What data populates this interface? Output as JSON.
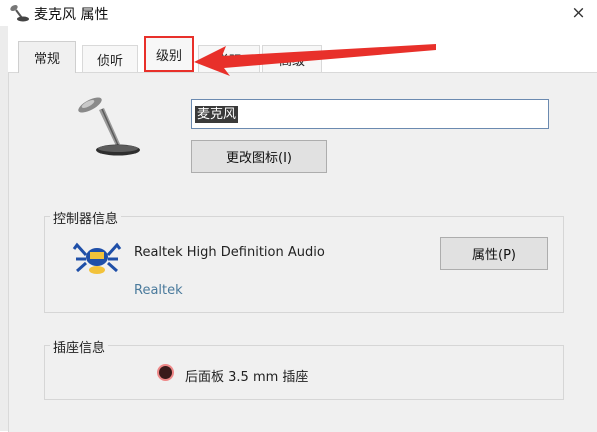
{
  "window": {
    "title": "麦克风 属性",
    "close_label": "×"
  },
  "tabs": [
    {
      "label": "常规",
      "active": true
    },
    {
      "label": "侦听"
    },
    {
      "label": "级别",
      "highlighted": true
    },
    {
      "label": "增强"
    },
    {
      "label": "高级"
    }
  ],
  "general": {
    "device_name_value": "麦克风",
    "change_icon_label": "更改图标(I)"
  },
  "controller": {
    "legend": "控制器信息",
    "device": "Realtek High Definition Audio",
    "vendor": "Realtek",
    "properties_label": "属性(P)"
  },
  "jack": {
    "legend": "插座信息",
    "description": "后面板 3.5 mm 插座",
    "dot_color": "#3a1a1a"
  },
  "annotation": {
    "color": "#e8302a",
    "points_to": "级别"
  },
  "icons": [
    "microphone-icon",
    "realtek-crab-icon",
    "close-icon"
  ]
}
